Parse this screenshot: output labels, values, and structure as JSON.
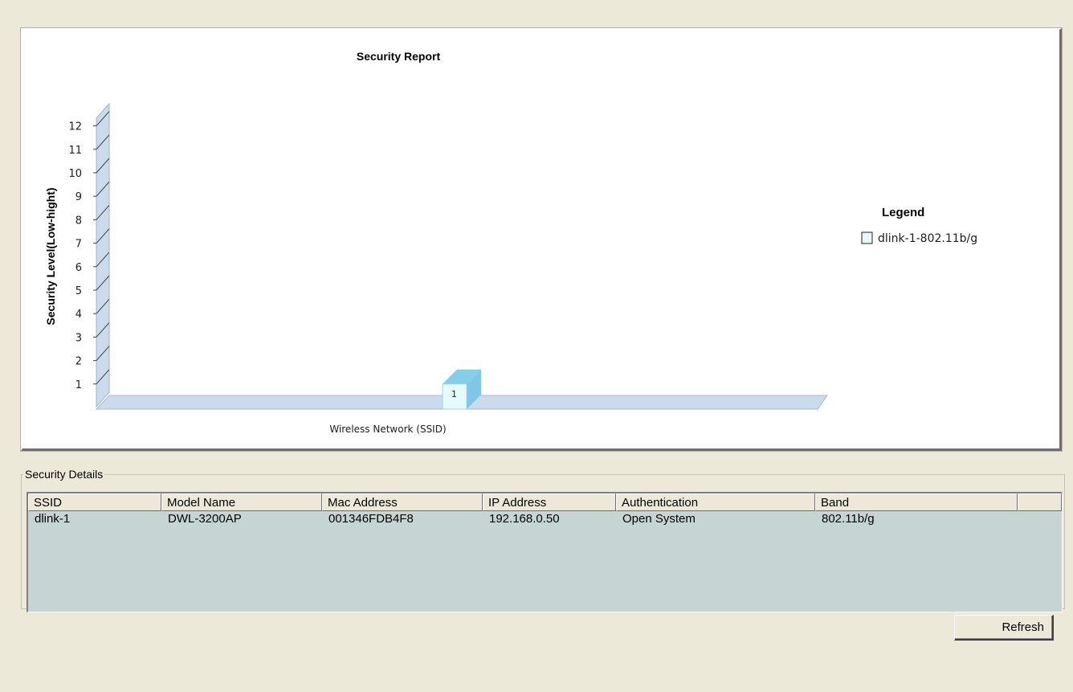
{
  "chart_data": {
    "type": "bar",
    "title": "Security Report",
    "ylabel": "Security Level(Low-hight)",
    "xlabel": "Wireless Network (SSID)",
    "ylim": [
      0,
      12
    ],
    "yticks": [
      1,
      2,
      3,
      4,
      5,
      6,
      7,
      8,
      9,
      10,
      11,
      12
    ],
    "categories": [
      "dlink-1-802.11b/g"
    ],
    "series": [
      {
        "name": "dlink-1-802.11b/g",
        "values": [
          1
        ]
      }
    ],
    "data_labels": [
      "1"
    ],
    "legend_title": "Legend",
    "legend_position": "right",
    "bar_color": "#e6fafb",
    "bar_side_color": "#7cc8e6",
    "floor_color": "#cbdbee",
    "three_d": true,
    "grid": false
  },
  "details": {
    "label": "Security Details",
    "columns": [
      "SSID",
      "Model Name",
      "Mac Address",
      "IP Address",
      "Authentication",
      "Band",
      ""
    ],
    "rows": [
      [
        "dlink-1",
        "DWL-3200AP",
        "001346FDB4F8",
        "192.168.0.50",
        "Open System",
        "802.11b/g"
      ]
    ]
  },
  "buttons": {
    "refresh": "Refresh"
  }
}
